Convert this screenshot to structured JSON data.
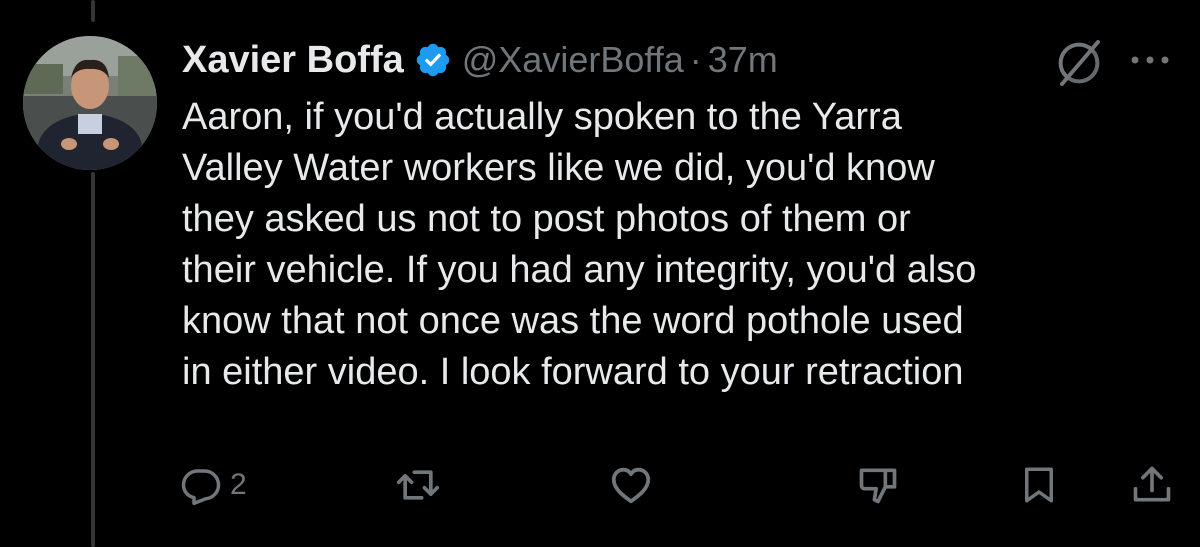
{
  "post": {
    "author": {
      "display_name": "Xavier Boffa",
      "handle": "@XavierBoffa",
      "verified": true,
      "avatar_icon": "profile-photo"
    },
    "separator": "·",
    "timestamp": "37m",
    "text_lines": [
      "Aaron, if you'd actually spoken to the Yarra",
      "Valley Water workers like we did, you'd know",
      "they asked us not to post photos of them or",
      "their vehicle. If you had any integrity, you'd also",
      "know that not once was the word pothole used",
      "in either video. I look forward to your retraction"
    ],
    "actions": {
      "reply_count": "2",
      "reply_icon": "reply-icon",
      "repost_icon": "repost-icon",
      "like_icon": "heart-icon",
      "downvote_icon": "thumbs-down-icon",
      "bookmark_icon": "bookmark-icon",
      "share_icon": "share-icon"
    },
    "top_icons": {
      "grok": "grok-icon",
      "more": "more-icon"
    }
  },
  "colors": {
    "background": "#000000",
    "text_primary": "#e7e9ea",
    "text_secondary": "#71767b",
    "verified_blue": "#1d9bf0",
    "thread_line": "#333639"
  }
}
